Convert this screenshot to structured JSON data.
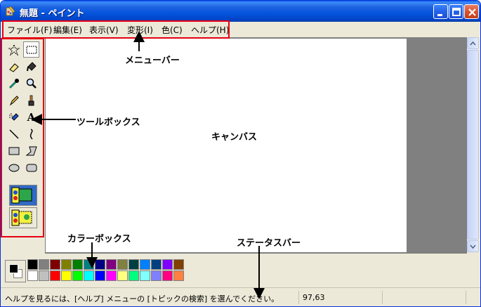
{
  "window": {
    "title": "無題 - ペイント"
  },
  "menubar": {
    "items": [
      {
        "label": "ファイル(F)"
      },
      {
        "label": "編集(E)"
      },
      {
        "label": "表示(V)"
      },
      {
        "label": "変形(I)"
      },
      {
        "label": "色(C)"
      },
      {
        "label": "ヘルプ(H)"
      }
    ]
  },
  "toolbox": {
    "tools": [
      {
        "icon": "free-select-icon"
      },
      {
        "icon": "rect-select-icon",
        "active": true
      },
      {
        "icon": "eraser-icon"
      },
      {
        "icon": "fill-bucket-icon"
      },
      {
        "icon": "color-picker-icon"
      },
      {
        "icon": "magnifier-icon"
      },
      {
        "icon": "pencil-icon"
      },
      {
        "icon": "brush-icon"
      },
      {
        "icon": "airbrush-icon"
      },
      {
        "icon": "text-icon",
        "glyph": "A"
      },
      {
        "icon": "line-icon"
      },
      {
        "icon": "curve-icon"
      },
      {
        "icon": "rectangle-icon"
      },
      {
        "icon": "polygon-icon"
      },
      {
        "icon": "ellipse-icon"
      },
      {
        "icon": "rounded-rect-icon"
      }
    ],
    "options": [
      {
        "icon": "opaque-mode-icon",
        "selected": true
      },
      {
        "icon": "transparent-mode-icon",
        "selected": false
      }
    ]
  },
  "colorbox": {
    "foreground": "#000000",
    "background": "#ffffff",
    "palette_top": [
      "#000000",
      "#808080",
      "#800000",
      "#808000",
      "#008000",
      "#008080",
      "#000080",
      "#800080",
      "#808040",
      "#004040",
      "#0080ff",
      "#004080",
      "#8000ff",
      "#804000"
    ],
    "palette_bottom": [
      "#ffffff",
      "#c0c0c0",
      "#ff0000",
      "#ffff00",
      "#00ff00",
      "#00ffff",
      "#0000ff",
      "#ff00ff",
      "#ffff80",
      "#00ff80",
      "#80ffff",
      "#8080ff",
      "#ff0080",
      "#ff8040"
    ]
  },
  "statusbar": {
    "help_text": "ヘルプを見るには、[ヘルプ] メニューの [トピックの検索] を選んでください。",
    "coords": "97,63"
  },
  "annotations": {
    "menubar": "メニューバー",
    "toolbox": "ツールボックス",
    "canvas": "キャンバス",
    "colorbox": "カラーボックス",
    "statusbar": "ステータスバー"
  }
}
